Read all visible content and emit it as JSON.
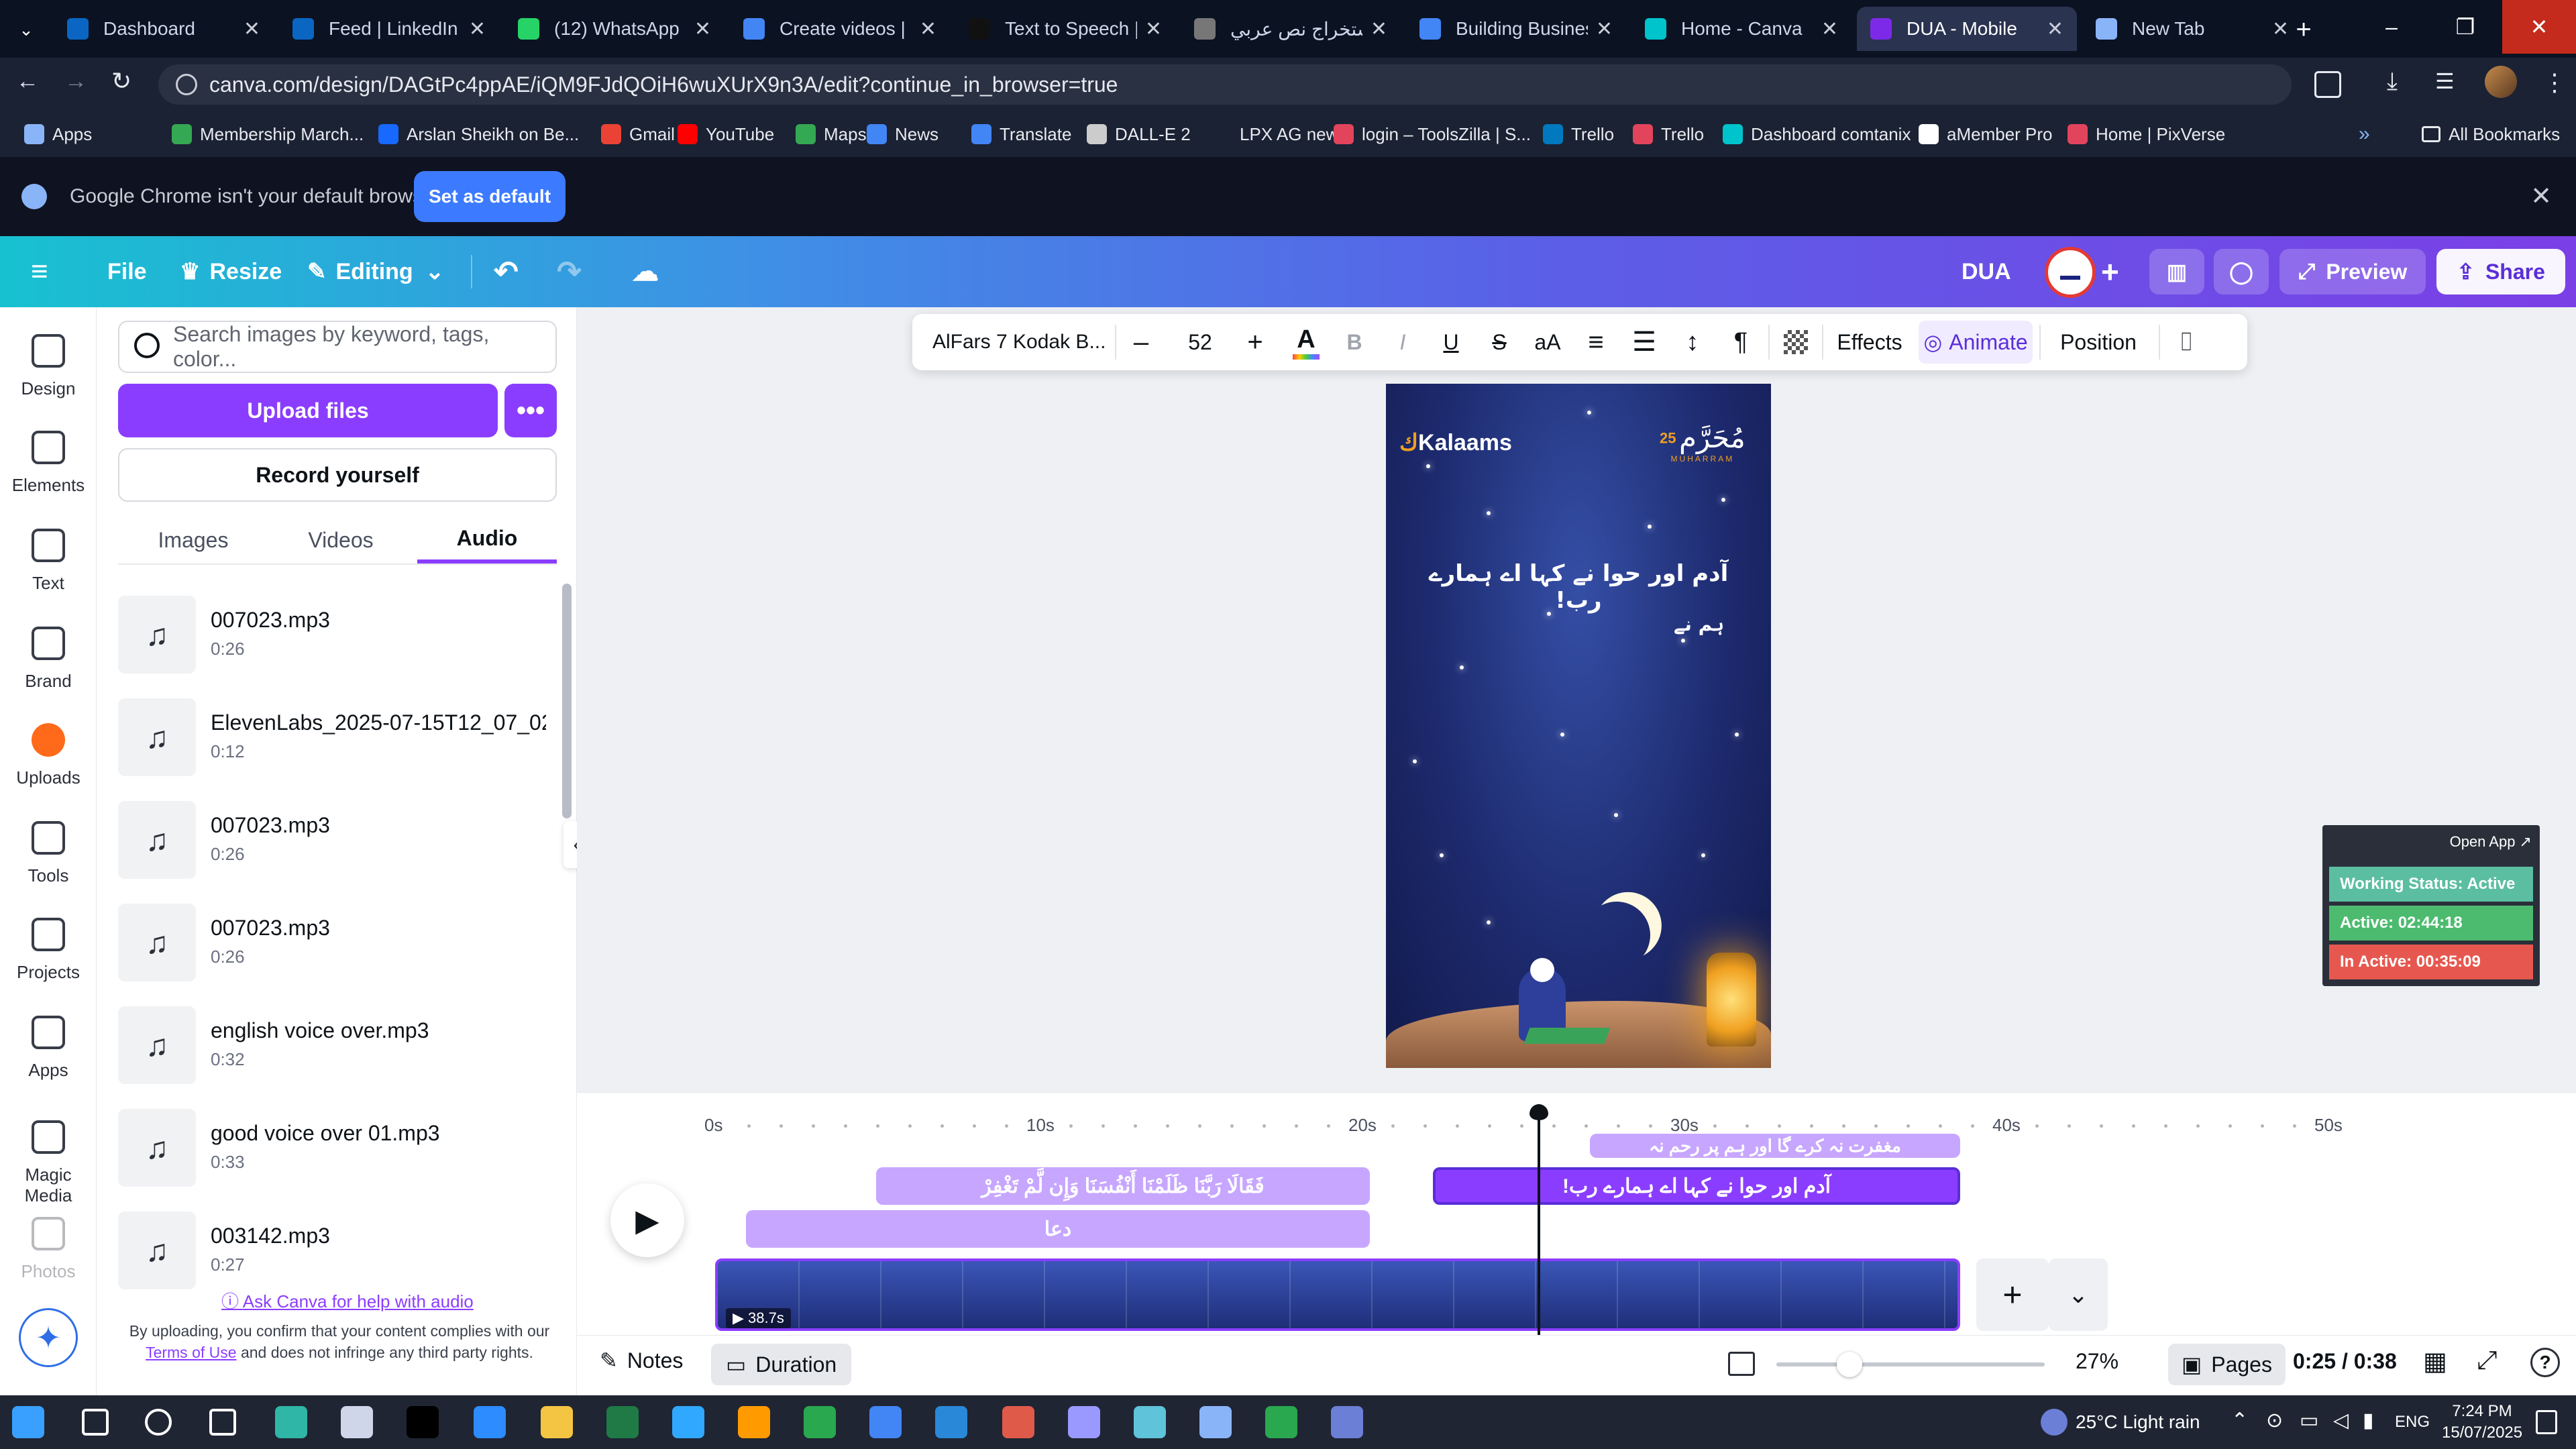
{
  "browser": {
    "tabs": [
      {
        "label": "Dashboard",
        "color": "#0a66c2",
        "active": false
      },
      {
        "label": "Feed | LinkedIn",
        "color": "#0a66c2",
        "active": false
      },
      {
        "label": "(12) WhatsApp",
        "color": "#25d366",
        "active": false
      },
      {
        "label": "Create videos | Fr",
        "color": "#4285f4",
        "active": false
      },
      {
        "label": "Text to Speech | E",
        "color": "#111111",
        "active": false
      },
      {
        "label": "استخراج نص عربي",
        "color": "#777777",
        "active": false
      },
      {
        "label": "Building Business",
        "color": "#4285f4",
        "active": false
      },
      {
        "label": "Home - Canva",
        "color": "#00c4cc",
        "active": false
      },
      {
        "label": "DUA - Mobile",
        "color": "#7d2ae8",
        "active": true
      },
      {
        "label": "New Tab",
        "color": "#8ab4f8",
        "active": false
      }
    ],
    "url": "canva.com/design/DAGtPc4ppAE/iQM9FJdQOiH6wuXUrX9n3A/edit?continue_in_browser=true",
    "bookmarks": [
      {
        "label": "Apps",
        "color": "#8ab4f8"
      },
      {
        "label": "Membership March...",
        "color": "#34a853"
      },
      {
        "label": "Arslan Sheikh on Be...",
        "color": "#1769ff"
      },
      {
        "label": "Gmail",
        "color": "#ea4335"
      },
      {
        "label": "YouTube",
        "color": "#ff0000"
      },
      {
        "label": "Maps",
        "color": "#34a853"
      },
      {
        "label": "News",
        "color": "#4285f4"
      },
      {
        "label": "Translate",
        "color": "#4285f4"
      },
      {
        "label": "DALL-E 2",
        "color": "#cccccc"
      },
      {
        "label": "LPX AG new",
        "color": "#1b2233"
      },
      {
        "label": "login – ToolsZilla | S...",
        "color": "#e2445c"
      },
      {
        "label": "Trello",
        "color": "#0079bf"
      },
      {
        "label": "Trello",
        "color": "#e2445c"
      },
      {
        "label": "Dashboard comtanix",
        "color": "#00c4cc"
      },
      {
        "label": "aMember Pro",
        "color": "#ffffff"
      },
      {
        "label": "Home | PixVerse",
        "color": "#e2445c"
      }
    ],
    "all_bookmarks": "All Bookmarks",
    "infobar_text": "Google Chrome isn't your default browser",
    "set_default": "Set as default"
  },
  "canva_header": {
    "file": "File",
    "resize": "Resize",
    "editing": "Editing",
    "title": "DUA",
    "preview": "Preview",
    "share": "Share"
  },
  "rail": [
    {
      "label": "Design",
      "icon": "design-icon"
    },
    {
      "label": "Elements",
      "icon": "elements-icon"
    },
    {
      "label": "Text",
      "icon": "text-icon"
    },
    {
      "label": "Brand",
      "icon": "brand-icon"
    },
    {
      "label": "Uploads",
      "icon": "uploads-icon"
    },
    {
      "label": "Tools",
      "icon": "tools-icon"
    },
    {
      "label": "Projects",
      "icon": "projects-icon"
    },
    {
      "label": "Apps",
      "icon": "apps-icon"
    },
    {
      "label": "Magic Media",
      "icon": "magic-media-icon"
    },
    {
      "label": "Photos",
      "icon": "photos-icon"
    }
  ],
  "panel": {
    "search_placeholder": "Search images by keyword, tags, color...",
    "upload": "Upload files",
    "record": "Record yourself",
    "tabs": [
      "Images",
      "Videos",
      "Audio"
    ],
    "audio_files": [
      {
        "name": "007023.mp3",
        "duration": "0:26"
      },
      {
        "name": "ElevenLabs_2025-07-15T12_07_02_...",
        "duration": "0:12"
      },
      {
        "name": "007023.mp3",
        "duration": "0:26"
      },
      {
        "name": "007023.mp3",
        "duration": "0:26"
      },
      {
        "name": "english voice over.mp3",
        "duration": "0:32"
      },
      {
        "name": "good voice over 01.mp3",
        "duration": "0:33"
      },
      {
        "name": "003142.mp3",
        "duration": "0:27"
      }
    ],
    "help_link": "Ask Canva for help with audio",
    "disclaimer_1": "By uploading, you confirm that your content complies with our",
    "terms": "Terms of Use",
    "disclaimer_2": "and does not infringe any third party rights."
  },
  "toolbar": {
    "font": "AlFars 7 Kodak B...",
    "size": "52",
    "effects": "Effects",
    "animate": "Animate",
    "position": "Position"
  },
  "design": {
    "brand": "Kalaams",
    "badge_ar": "مُحَرَّم",
    "badge_num": "25",
    "badge_sub": "MUHARRAM",
    "line1": "آدم اور حوا نے کہا اے ہمارے رب!",
    "line2": "ہم نے"
  },
  "timeline": {
    "ticks": [
      "0s",
      "10s",
      "20s",
      "30s",
      "40s",
      "50s"
    ],
    "clip_top": "مغفرت نہ کرے گا اور ہم پر رحم نہ",
    "clip_arabic": "فَقَالَا رَبَّنَا ظَلَمْنَا أَنْفُسَنَا وَإِن لَّمْ تَغْفِرْ",
    "clip_selected": "آدم اور حوا نے کہا اے ہمارے رب!",
    "clip_dua": "دعا",
    "video_duration": "38.7s"
  },
  "bottom": {
    "notes": "Notes",
    "duration": "Duration",
    "zoom": "27%",
    "pages": "Pages",
    "time": "0:25 / 0:38"
  },
  "widget": {
    "open_app": "Open App ↗",
    "status": "Working Status: Active",
    "active": "Active: 02:44:18",
    "inactive": "In Active: 00:35:09"
  },
  "taskbar": {
    "weather": "25°C Light rain",
    "lang": "ENG",
    "time": "7:24 PM",
    "date": "15/07/2025"
  }
}
